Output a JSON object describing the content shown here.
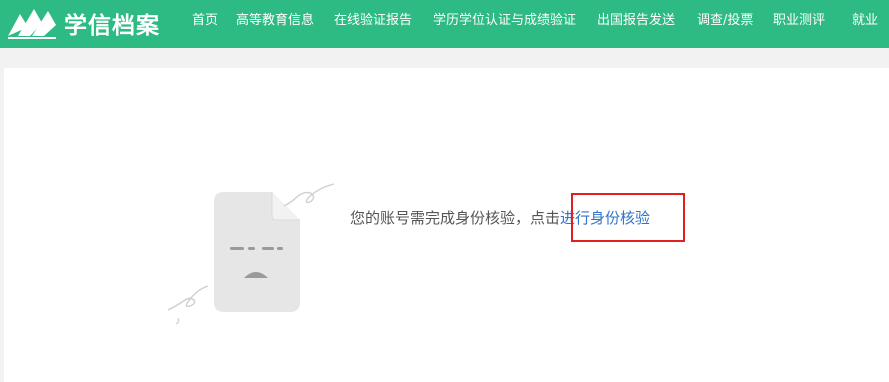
{
  "header": {
    "brand": "学信档案",
    "nav": [
      {
        "label": "首页",
        "id": "home"
      },
      {
        "label": "高等教育信息",
        "id": "higher-education-info"
      },
      {
        "label": "在线验证报告",
        "id": "online-verification-report"
      },
      {
        "label": "学历学位认证与成绩验证",
        "id": "degree-certification"
      },
      {
        "label": "出国报告发送",
        "id": "abroad-report-send"
      },
      {
        "label": "调查/投票",
        "id": "survey-vote"
      },
      {
        "label": "职业测评",
        "id": "career-assessment"
      },
      {
        "label": "就业",
        "id": "employment"
      }
    ]
  },
  "main": {
    "message_prefix": "您的账号需完成身份核验，点击",
    "verify_link": "进行身份核验"
  },
  "colors": {
    "header_bg": "#2dba83",
    "link": "#2f74c8",
    "highlight": "#e02020"
  },
  "icons": {
    "logo": "open-book-logo-icon",
    "illustration": "sad-document-icon"
  }
}
